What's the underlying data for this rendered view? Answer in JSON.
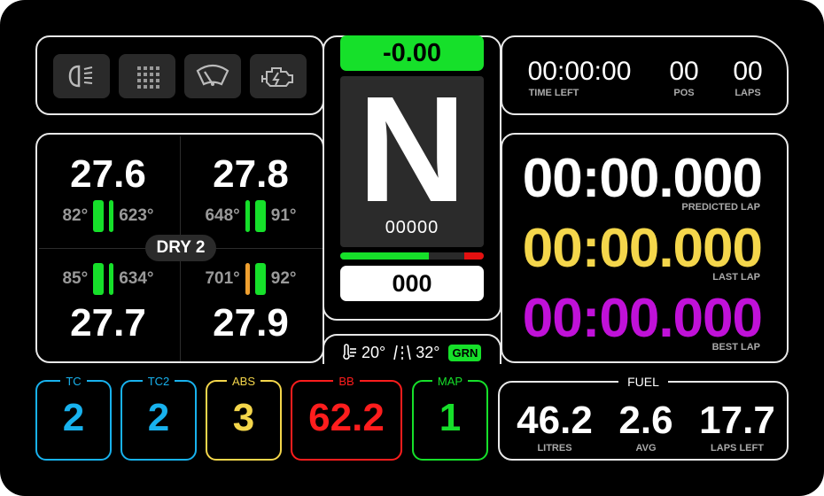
{
  "colors": {
    "green": "#16e02a",
    "yellow": "#f4d64b",
    "purple": "#c011d8",
    "blue": "#18b2ee",
    "orange": "#f0a030",
    "red": "#ff1d1d"
  },
  "icons": [
    "headlight-icon",
    "rain-light-icon",
    "wiper-icon",
    "engine-icon"
  ],
  "tyres": {
    "compound": "DRY 2",
    "fl": {
      "pressure": "27.6",
      "temp_outer": "82°",
      "temp_brake": "623°"
    },
    "fr": {
      "pressure": "27.8",
      "temp_brake": "648°",
      "temp_outer": "91°"
    },
    "rl": {
      "pressure": "27.7",
      "temp_outer": "85°",
      "temp_brake": "634°"
    },
    "rr": {
      "pressure": "27.9",
      "temp_brake": "701°",
      "temp_outer": "92°"
    }
  },
  "center": {
    "delta": "-0.00",
    "gear": "N",
    "rpm": "00000",
    "speed": "000",
    "shift_fraction": 0.62
  },
  "weather": {
    "air_temp": "20°",
    "track_temp": "32°",
    "flag": "GRN"
  },
  "session": {
    "time_left": "00:00:00",
    "time_left_label": "TIME LEFT",
    "pos": "00",
    "pos_label": "POS",
    "laps": "00",
    "laps_label": "LAPS"
  },
  "laptimes": {
    "predicted": "00:00.000",
    "predicted_label": "PREDICTED LAP",
    "last": "00:00.000",
    "last_label": "LAST LAP",
    "best": "00:00.000",
    "best_label": "BEST LAP"
  },
  "settings": [
    {
      "label": "TC",
      "value": "2"
    },
    {
      "label": "TC2",
      "value": "2"
    },
    {
      "label": "ABS",
      "value": "3"
    },
    {
      "label": "BB",
      "value": "62.2"
    },
    {
      "label": "MAP",
      "value": "1"
    }
  ],
  "fuel": {
    "title": "FUEL",
    "litres": "46.2",
    "litres_label": "LITRES",
    "avg": "2.6",
    "avg_label": "AVG",
    "laps_left": "17.7",
    "laps_left_label": "LAPS LEFT"
  }
}
